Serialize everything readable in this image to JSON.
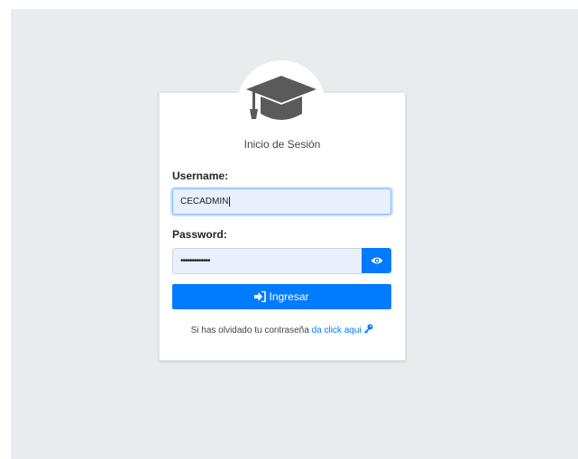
{
  "login": {
    "title": "Inicio de Sesión",
    "username_label": "Username:",
    "username_value": "CECADMIN",
    "password_label": "Password:",
    "password_value": "•••••••••••••",
    "submit_label": "Ingresar",
    "forgot_text": "Si has olvidado tu contraseña ",
    "forgot_link": "da click aqui"
  },
  "colors": {
    "primary": "#007bff",
    "background": "#e9ecef",
    "input_fill": "#e8f0fe"
  },
  "icons": [
    "graduation-cap-icon",
    "eye-icon",
    "sign-in-icon",
    "key-icon"
  ]
}
